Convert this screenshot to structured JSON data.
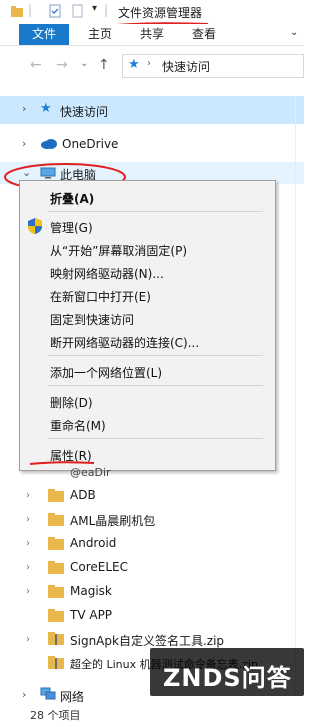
{
  "window": {
    "title": "文件资源管理器"
  },
  "ribbon": {
    "tabs": [
      "文件",
      "主页",
      "共享",
      "查看"
    ]
  },
  "address": {
    "location": "快速访问"
  },
  "nav": {
    "quick_access": "快速访问",
    "onedrive": "OneDrive",
    "this_pc": "此电脑",
    "network": "网络"
  },
  "context_menu": {
    "collapse": "折叠(A)",
    "manage": "管理(G)",
    "unpin_start": "从“开始”屏幕取消固定(P)",
    "map_drive": "映射网络驱动器(N)...",
    "open_new_window": "在新窗口中打开(E)",
    "pin_quick": "固定到快速访问",
    "disconnect_drive": "断开网络驱动器的连接(C)...",
    "add_network_location": "添加一个网络位置(L)",
    "delete": "删除(D)",
    "rename": "重命名(M)",
    "properties": "属性(R)"
  },
  "folders": {
    "partial": "@eaDir",
    "items": [
      "ADB",
      "AML晶晨刷机包",
      "Android",
      "CoreELEC",
      "Magisk",
      "TV APP",
      "SignApk自定义签名工具.zip",
      "超全的 Linux 机器测试命令备忘表.zip"
    ]
  },
  "status": {
    "count": "28 个项目"
  },
  "watermark": {
    "text": "ZNDS问答"
  },
  "colors": {
    "accent": "#1979ca",
    "annotation_red": "#e0201e",
    "folder": "#e8b84a"
  }
}
